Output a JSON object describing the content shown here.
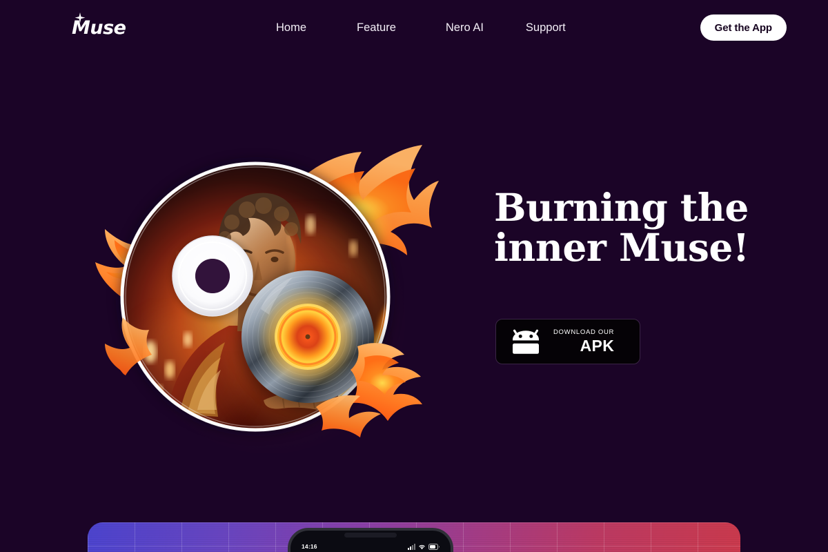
{
  "brand": {
    "logo_text": "Muse",
    "sparkle_icon": "sparkle-icon"
  },
  "nav": {
    "items": [
      {
        "label": "Home"
      },
      {
        "label": "Feature"
      },
      {
        "label": "Nero AI"
      },
      {
        "label": "Support"
      }
    ],
    "cta_label": "Get the App"
  },
  "hero": {
    "headline": "Burning the\ninner Muse!",
    "artwork": {
      "name": "burning-cd-artwork",
      "description": "Compact disc with classical figure holding a flaming vinyl record, surrounded by stylized flames",
      "disc_label": "cd-disc",
      "vinyl_label": "flaming-vinyl-record",
      "flame_label": "flame-graphic"
    },
    "download_button": {
      "sub_label": "DOWNLOAD OUR",
      "main_label": "APK",
      "icon": "android-robot-icon"
    }
  },
  "showcase": {
    "phone": {
      "time": "14:16",
      "signal_icon": "cellular-signal-icon",
      "wifi_icon": "wifi-icon",
      "battery_icon": "battery-icon"
    }
  },
  "colors": {
    "background": "#1b0427",
    "text_primary": "#ffffff",
    "cta_background": "#ffffff",
    "cta_text": "#16031f",
    "apk_background": "#050206",
    "flame_orange": "#ff6b1a",
    "flame_light": "#ffa348",
    "flame_outline": "#e8361c",
    "panel_gradient_start": "#4c44cf",
    "panel_gradient_end": "#cb3a4d"
  }
}
